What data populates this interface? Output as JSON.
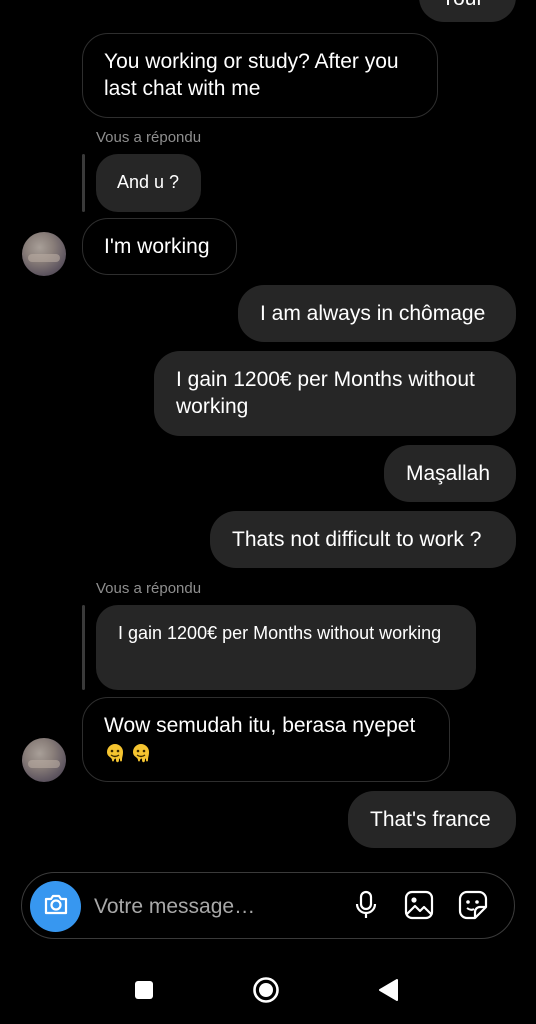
{
  "messages": {
    "top_cut": "Your",
    "m1": "You working or study? After you last chat with me",
    "reply1_caption": "Vous a répondu",
    "reply1_quote": "And u ?",
    "m2": "I'm working",
    "m3": "I am always in chômage",
    "m4": "I gain 1200€ per Months without working",
    "m5": "Maşallah",
    "m6": "Thats not difficult to work ?",
    "reply2_caption": "Vous a répondu",
    "reply2_quote": "I gain 1200€ per Months without working",
    "m7": "Wow semudah itu, berasa nyepet",
    "m8": "That's france"
  },
  "composer": {
    "placeholder": "Votre message…"
  },
  "icons": {
    "camera": "camera-icon",
    "microphone": "microphone-icon",
    "gallery": "gallery-icon",
    "sticker": "sticker-icon",
    "emoji": "melting-face-emoji"
  },
  "colors": {
    "background": "#000000",
    "outgoing_bubble": "#262626",
    "accent": "#3797f0",
    "caption": "#8e8e8e"
  }
}
